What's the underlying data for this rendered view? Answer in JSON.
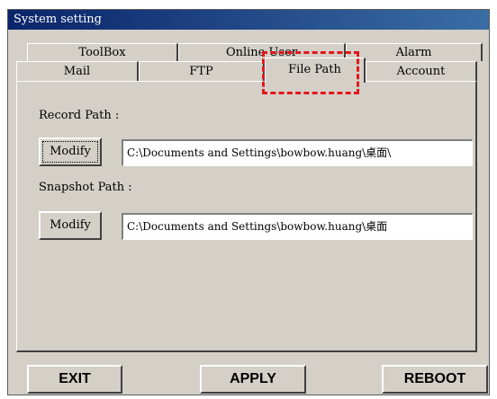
{
  "window": {
    "title": "System setting"
  },
  "tabs": {
    "row1": [
      "ToolBox",
      "Online User",
      "Alarm"
    ],
    "row2": [
      "Mail",
      "FTP",
      "File Path",
      "Account"
    ],
    "active": "File Path"
  },
  "panel": {
    "record_label": "Record Path :",
    "record_button": "Modify",
    "record_path": "C:\\Documents and Settings\\bowbow.huang\\桌面\\",
    "snapshot_label": "Snapshot Path :",
    "snapshot_button": "Modify",
    "snapshot_path": "C:\\Documents and Settings\\bowbow.huang\\桌面"
  },
  "buttons": {
    "exit": "EXIT",
    "apply": "APPLY",
    "reboot": "REBOOT"
  },
  "colors": {
    "highlight": "#e3161b",
    "titlebar": "#0a246a",
    "face": "#d4d0c8"
  }
}
